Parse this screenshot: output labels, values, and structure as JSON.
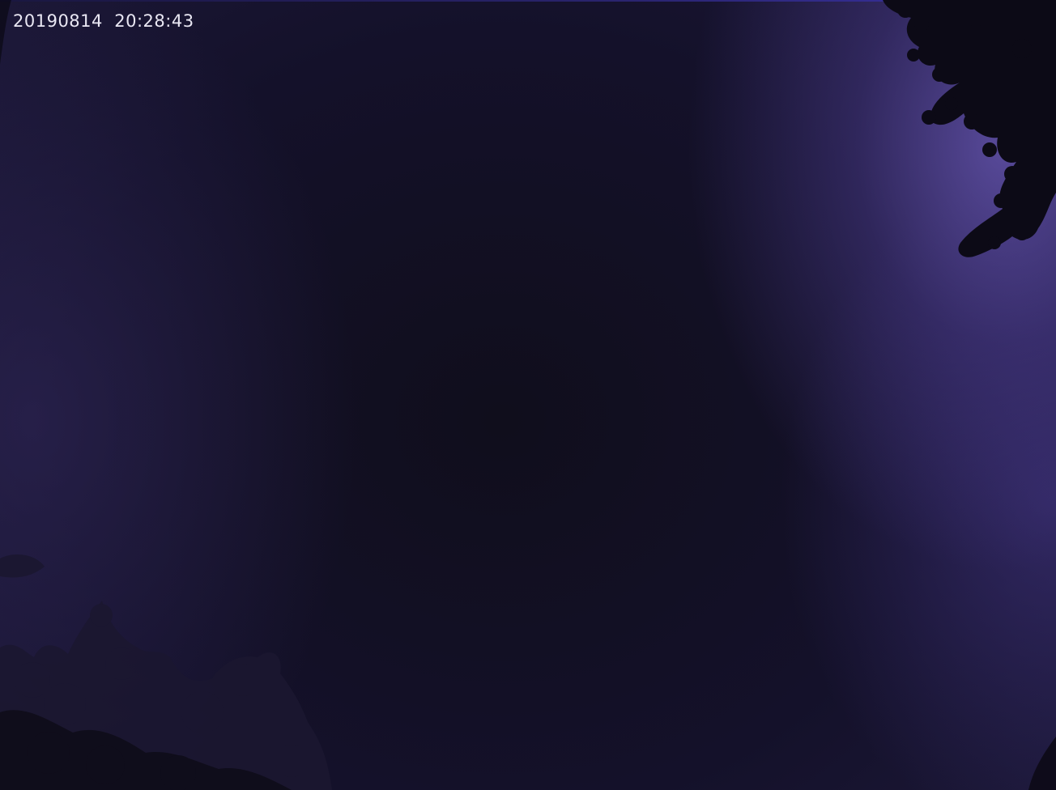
{
  "overlay": {
    "timestamp": "20190814  20:28:43"
  },
  "scene": {
    "subject": "night sky with lightning glow",
    "sky_color_dark": "#12101f",
    "sky_color_glow": "#6e5cbe",
    "foliage_color": "#0c0a16",
    "foliage_color_dim": "#1b1730"
  }
}
